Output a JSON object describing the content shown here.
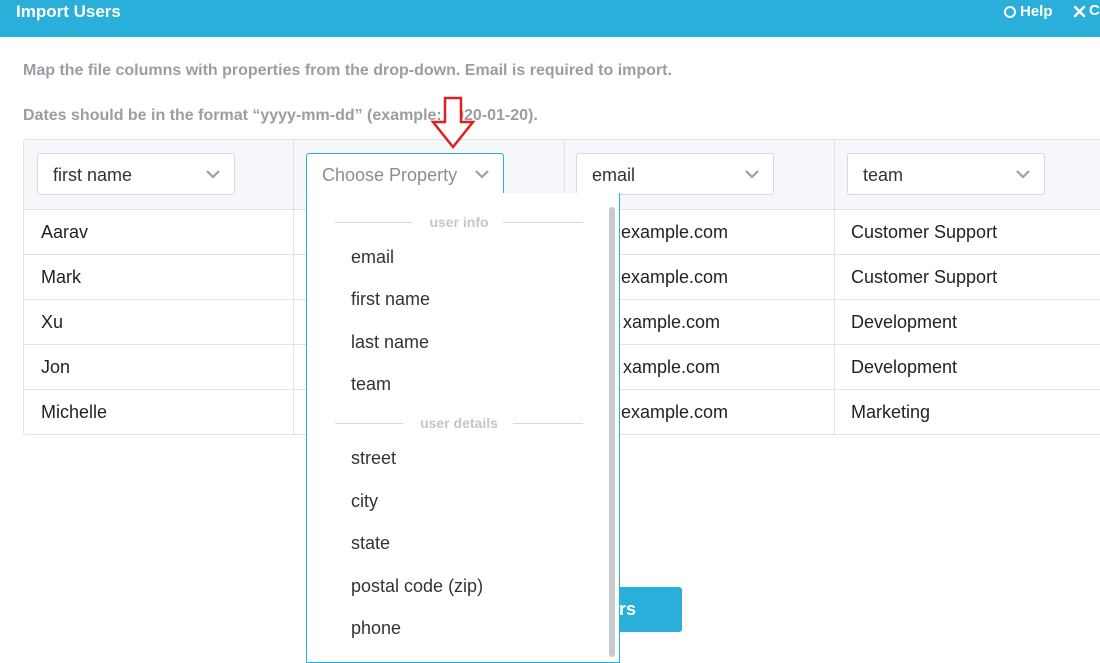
{
  "window": {
    "title": "Import Users",
    "help_label": "Help",
    "close_label": "C"
  },
  "instructions": [
    "Map the file columns with properties from the drop-down. Email is required to import.",
    "Dates should be in the format “yyyy-mm-dd” (example: 2020-01-20)."
  ],
  "columns": [
    {
      "selected": "first name"
    },
    {
      "selected": "Choose Property"
    },
    {
      "selected": "email"
    },
    {
      "selected": "team"
    }
  ],
  "rows": [
    {
      "first": "Aarav",
      "email": "example.com",
      "team": "Customer Support"
    },
    {
      "first": "Mark",
      "email": "example.com",
      "team": "Customer Support"
    },
    {
      "first": "Xu",
      "email": "xample.com",
      "team": "Development"
    },
    {
      "first": "Jon",
      "email": "xample.com",
      "team": "Development"
    },
    {
      "first": "Michelle",
      "email": "example.com",
      "team": "Marketing"
    }
  ],
  "dropdown": {
    "group1": "user info",
    "group1_items": [
      "email",
      "first name",
      "last name",
      "team"
    ],
    "group2": "user details",
    "group2_items": [
      "street",
      "city",
      "state",
      "postal code (zip)",
      "phone"
    ]
  },
  "import_button": "rs",
  "colors": {
    "accent": "#29afd9",
    "arrow": "#e02020"
  }
}
